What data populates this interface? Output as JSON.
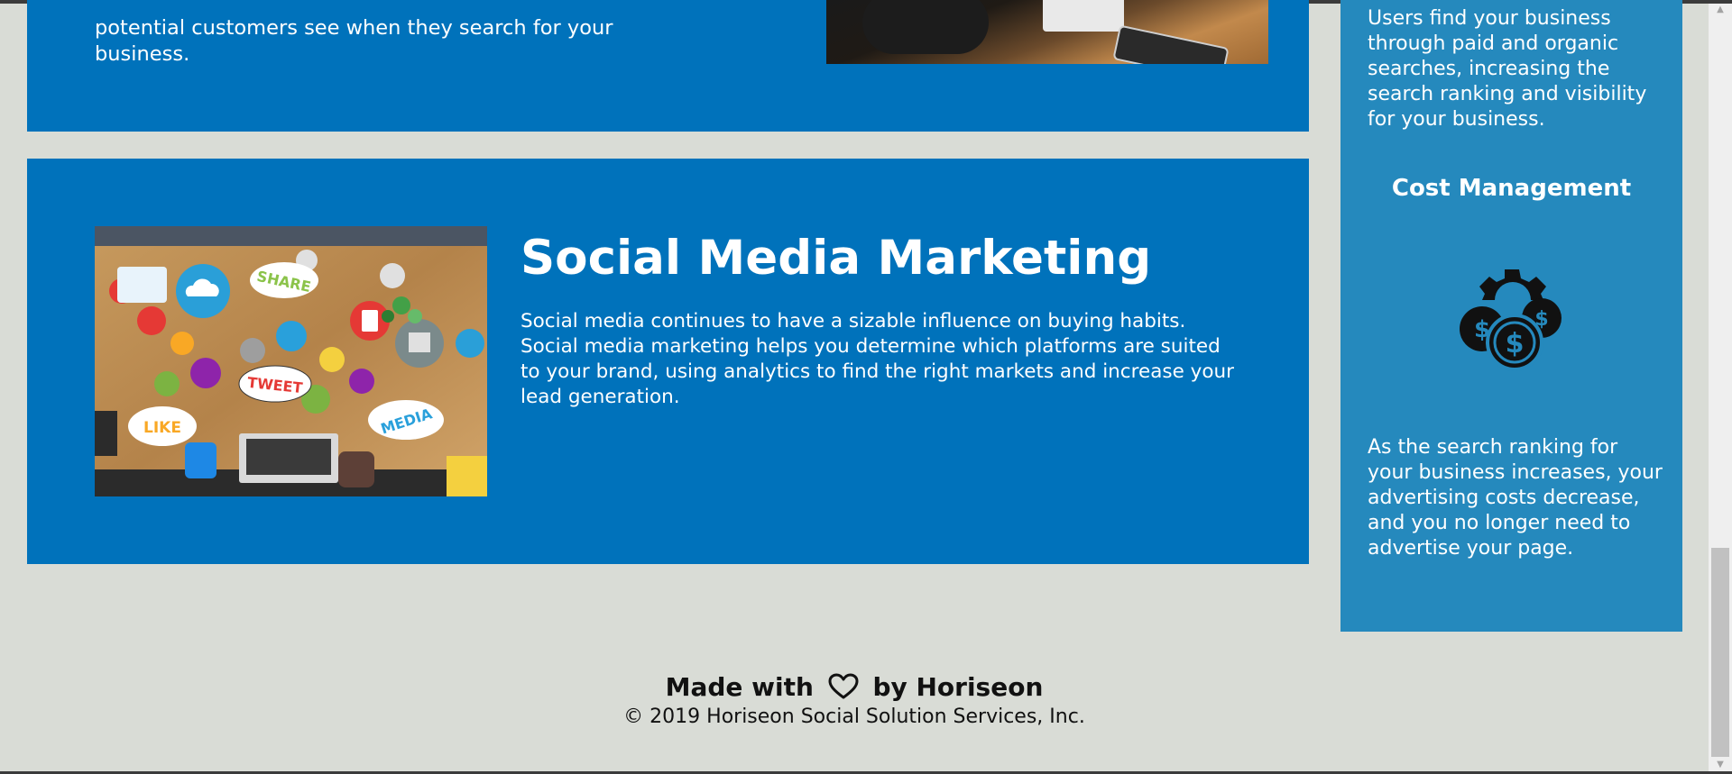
{
  "seo": {
    "text_fragment": "potential customers see when they search for your business."
  },
  "smm": {
    "title": "Social Media Marketing",
    "description": "Social media continues to have a sizable influence on buying habits. Social media marketing helps you determine which platforms are suited to your brand, using analytics to find the right markets and increase your lead generation.",
    "image_words": [
      "SHARE",
      "TWEET",
      "LIKE",
      "MEDIA"
    ]
  },
  "sidebar": {
    "paragraph_top": "Users find your business through paid and organic searches, increasing the search ranking and visibility for your business.",
    "heading": "Cost Management",
    "paragraph_bottom": "As the search ranking for your business increases, your advertising costs decrease, and you no longer need to advertise your page."
  },
  "footer": {
    "made_prefix": "Made with",
    "made_suffix": "by Horiseon",
    "copyright": "© 2019 Horiseon Social Solution Services, Inc."
  },
  "colors": {
    "card_blue": "#0072bb",
    "sidebar_blue": "#2589bd",
    "page_bg": "#d9dcd6"
  },
  "icons": [
    "heart-icon",
    "cost-management-icon"
  ]
}
